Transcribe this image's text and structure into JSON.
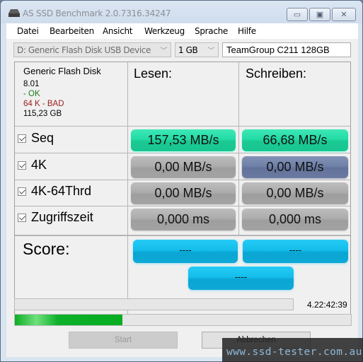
{
  "window": {
    "title": "AS SSD Benchmark 2.0.7316.34247",
    "controls": {
      "minimize": "minimize-icon",
      "maximize": "maximize-icon",
      "close": "close-icon"
    }
  },
  "menu": [
    "Datei",
    "Bearbeiten",
    "Ansicht",
    "Werkzeug",
    "Sprache",
    "Hilfe"
  ],
  "toolbar": {
    "drive_select": "D: Generic Flash Disk USB Device",
    "size_select": "1 GB",
    "name_input": "TeamGroup C211 128GB"
  },
  "info": {
    "device": "Generic Flash Disk",
    "firmware": "8.01",
    "driver_status": " - OK",
    "alignment": "64 K - BAD",
    "capacity": "115,23 GB"
  },
  "headers": {
    "read": "Lesen:",
    "write": "Schreiben:"
  },
  "rows": [
    {
      "label": "Seq",
      "checked": true,
      "read": "157,53 MB/s",
      "write": "66,68 MB/s"
    },
    {
      "label": "4K",
      "checked": true,
      "read": "0,00 MB/s",
      "write": "0,00 MB/s"
    },
    {
      "label": "4K-64Thrd",
      "checked": true,
      "read": "0,00 MB/s",
      "write": "0,00 MB/s"
    },
    {
      "label": "Zugriffszeit",
      "checked": true,
      "read": "0,000 ms",
      "write": "0,000 ms"
    }
  ],
  "score": {
    "label": "Score:",
    "read": "----",
    "write": "----",
    "total": "----"
  },
  "status": {
    "elapsed": "4.22:42:39",
    "progress_percent": 32
  },
  "buttons": {
    "start": "Start",
    "abort": "Abbrechen"
  },
  "watermark": "www.ssd-tester.com.au",
  "colors": {
    "seq_result": "#22dba5",
    "idle_result": "#acacac",
    "active_result": "#6f80a8",
    "score": "#14bdea",
    "progress": "#0db02a"
  }
}
